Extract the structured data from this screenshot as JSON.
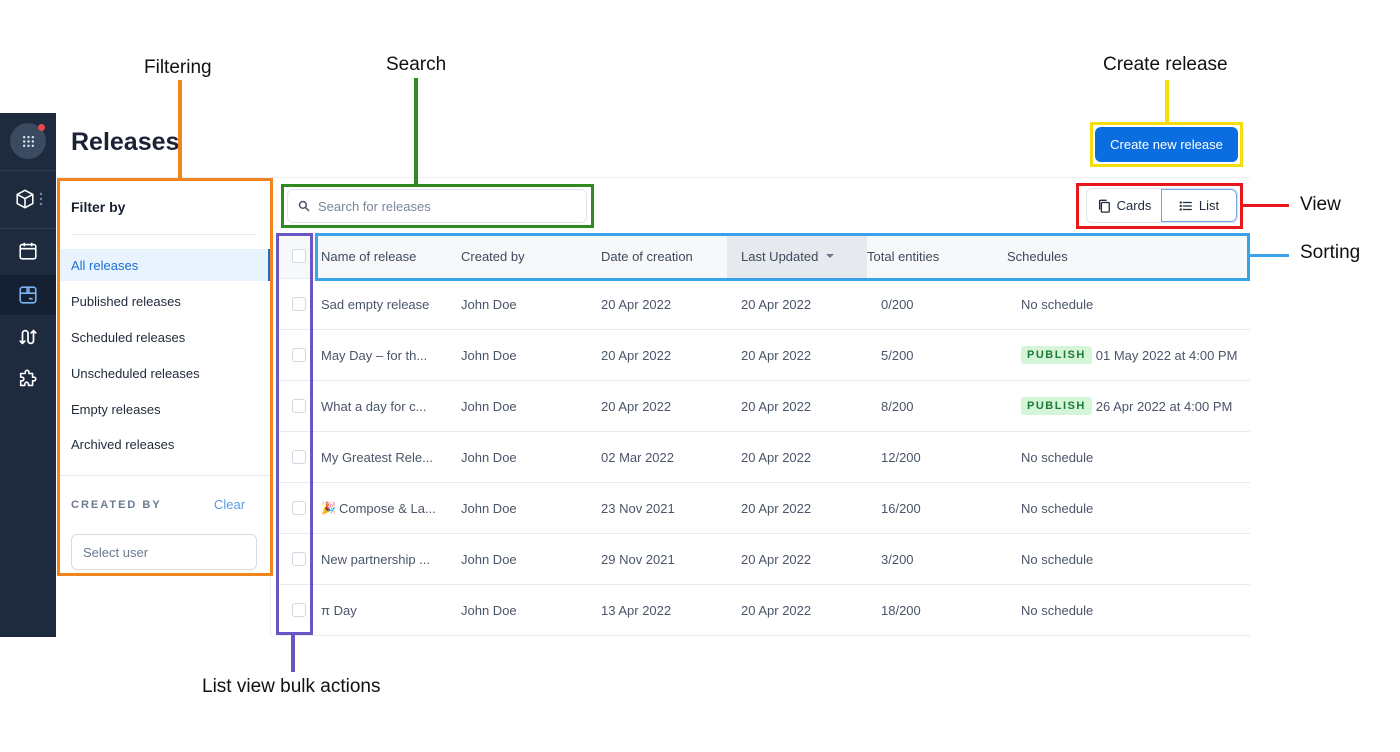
{
  "annotations": {
    "filtering": "Filtering",
    "search": "Search",
    "create_release": "Create release",
    "view": "View",
    "sorting": "Sorting",
    "bulk_actions": "List view bulk actions",
    "colors": {
      "filtering": "#f0841f",
      "search": "#2e8b1f",
      "create_release": "#f5dd0a",
      "view": "#e8171b",
      "sorting": "#3aa2ea",
      "bulk_actions": "#6a55c2"
    }
  },
  "nav": {
    "items": [
      {
        "name": "content-model",
        "icon": "cube-icon"
      },
      {
        "name": "schedule",
        "icon": "calendar-icon"
      },
      {
        "name": "releases",
        "icon": "release-box-icon",
        "active": true
      },
      {
        "name": "workflows",
        "icon": "arrows-icon"
      },
      {
        "name": "apps",
        "icon": "puzzle-icon"
      }
    ],
    "has_notification": true
  },
  "header": {
    "title": "Releases",
    "create_button": "Create new release"
  },
  "filter": {
    "title": "Filter by",
    "items": [
      {
        "label": "All releases",
        "active": true
      },
      {
        "label": "Published releases"
      },
      {
        "label": "Scheduled releases"
      },
      {
        "label": "Unscheduled releases"
      },
      {
        "label": "Empty releases"
      },
      {
        "label": "Archived releases"
      }
    ],
    "created_by_label": "CREATED BY",
    "clear_label": "Clear",
    "select_user_placeholder": "Select user"
  },
  "search": {
    "placeholder": "Search for releases",
    "value": ""
  },
  "view_toggle": {
    "cards_label": "Cards",
    "list_label": "List",
    "active": "List"
  },
  "table": {
    "columns": [
      "Name of release",
      "Created by",
      "Date of creation",
      "Last Updated",
      "Total entities",
      "Schedules"
    ],
    "sorted_column": "Last Updated",
    "rows": [
      {
        "name": "Sad empty release",
        "emoji": "",
        "created_by": "John Doe",
        "created": "20 Apr 2022",
        "updated": "20 Apr 2022",
        "total": "0/200",
        "badge": "",
        "schedule": "No schedule"
      },
      {
        "name": "May Day – for th...",
        "emoji": "",
        "created_by": "John Doe",
        "created": "20 Apr 2022",
        "updated": "20 Apr 2022",
        "total": "5/200",
        "badge": "PUBLISH",
        "schedule": "01 May 2022 at 4:00 PM"
      },
      {
        "name": "What a day for c...",
        "emoji": "",
        "created_by": "John Doe",
        "created": "20 Apr 2022",
        "updated": "20 Apr 2022",
        "total": "8/200",
        "badge": "PUBLISH",
        "schedule": "26 Apr 2022 at 4:00 PM"
      },
      {
        "name": "My Greatest Rele...",
        "emoji": "",
        "created_by": "John Doe",
        "created": "02 Mar 2022",
        "updated": "20 Apr 2022",
        "total": "12/200",
        "badge": "",
        "schedule": "No schedule"
      },
      {
        "name": "Compose & La...",
        "emoji": "🎉",
        "created_by": "John Doe",
        "created": "23 Nov 2021",
        "updated": "20 Apr 2022",
        "total": "16/200",
        "badge": "",
        "schedule": "No schedule"
      },
      {
        "name": "New partnership ...",
        "emoji": "",
        "created_by": "John Doe",
        "created": "29 Nov 2021",
        "updated": "20 Apr 2022",
        "total": "3/200",
        "badge": "",
        "schedule": "No schedule"
      },
      {
        "name": "π Day",
        "emoji": "",
        "created_by": "John Doe",
        "created": "13 Apr 2022",
        "updated": "20 Apr 2022",
        "total": "18/200",
        "badge": "",
        "schedule": "No schedule"
      }
    ]
  }
}
